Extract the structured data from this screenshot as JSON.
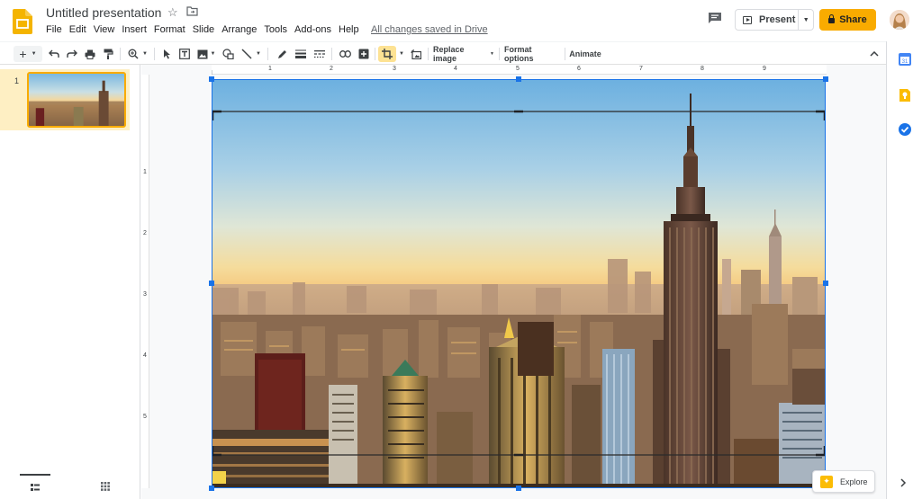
{
  "app": {
    "title": "Untitled presentation",
    "save_status": "All changes saved in Drive"
  },
  "menu": {
    "items": [
      "File",
      "Edit",
      "View",
      "Insert",
      "Format",
      "Slide",
      "Arrange",
      "Tools",
      "Add-ons",
      "Help"
    ]
  },
  "header": {
    "present_label": "Present",
    "share_label": "Share"
  },
  "toolbar": {
    "replace_image_label": "Replace image",
    "format_options_label": "Format options",
    "animate_label": "Animate"
  },
  "ruler": {
    "horizontal": [
      "1",
      "2",
      "3",
      "4",
      "5",
      "6",
      "7",
      "8",
      "9"
    ],
    "vertical": [
      "1",
      "2",
      "3",
      "4",
      "5"
    ]
  },
  "filmstrip": {
    "slides": [
      {
        "number": "1"
      }
    ]
  },
  "explore": {
    "label": "Explore"
  },
  "colors": {
    "accent": "#1a73e8",
    "share": "#f9ab00",
    "selected_slide": "#feefc3"
  }
}
